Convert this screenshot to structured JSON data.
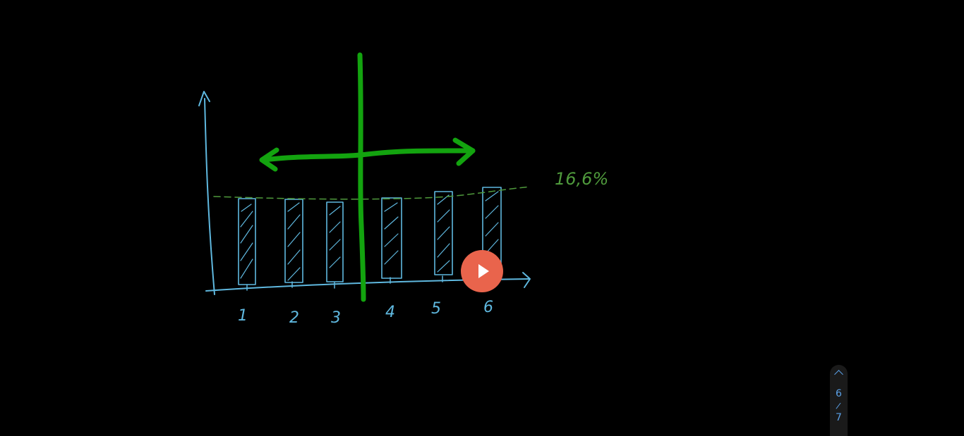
{
  "drawing": {
    "colors": {
      "axes": "#5fb8df",
      "bars": "#5fb8df",
      "cross": "#13a30f",
      "average_line": "#4f9a3c",
      "percent_label": "#4f9a3c"
    },
    "bar_labels": [
      "1",
      "2",
      "3",
      "4",
      "5",
      "6"
    ],
    "average_label": "16,6%"
  },
  "player": {
    "play_icon": "play-icon",
    "play_color": "#e9644c"
  },
  "pager": {
    "up_icon": "chevron-up-icon",
    "current": "6",
    "separator": "/",
    "total": "7"
  }
}
